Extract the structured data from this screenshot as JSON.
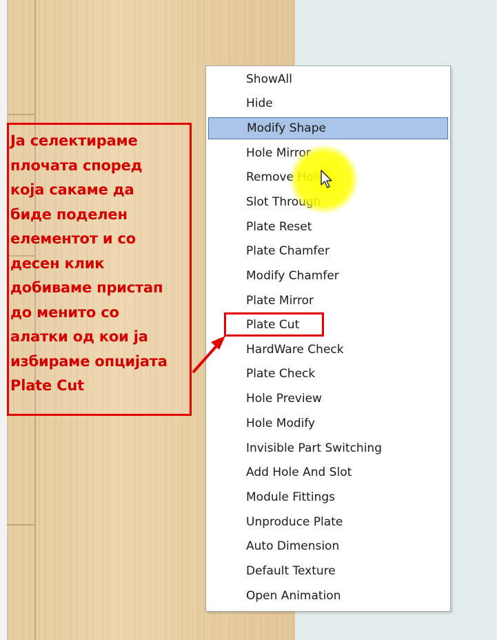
{
  "annotation": {
    "text": "Ја селектираме\nплочата според\nкоја сакаме да\nбиде поделен\nелементот и со\nдесен клик\nдобиваме пристап\nдо менито со\nалатки од кои ја\nизбираме опцијата\nPlate Cut"
  },
  "context_menu": {
    "items": [
      {
        "label": "ShowAll"
      },
      {
        "label": "Hide"
      },
      {
        "label": "Modify Shape"
      },
      {
        "label": "Hole Mirror"
      },
      {
        "label": "Remove Hole"
      },
      {
        "label": "Slot Through"
      },
      {
        "label": "Plate Reset"
      },
      {
        "label": "Plate Chamfer"
      },
      {
        "label": "Modify Chamfer"
      },
      {
        "label": "Plate Mirror"
      },
      {
        "label": "Plate Cut"
      },
      {
        "label": "HardWare Check"
      },
      {
        "label": "Plate Check"
      },
      {
        "label": "Hole Preview"
      },
      {
        "label": "Hole Modify"
      },
      {
        "label": "Invisible Part Switching"
      },
      {
        "label": "Add Hole And Slot"
      },
      {
        "label": "Module Fittings"
      },
      {
        "label": "Unproduce Plate"
      },
      {
        "label": "Auto Dimension"
      },
      {
        "label": "Default Texture"
      },
      {
        "label": "Open Animation"
      }
    ],
    "hovered_item": "Modify Shape",
    "highlighted_item": "Plate Cut"
  },
  "colors": {
    "highlight_red": "#e30000",
    "hover_blue": "#a9c4e6"
  }
}
